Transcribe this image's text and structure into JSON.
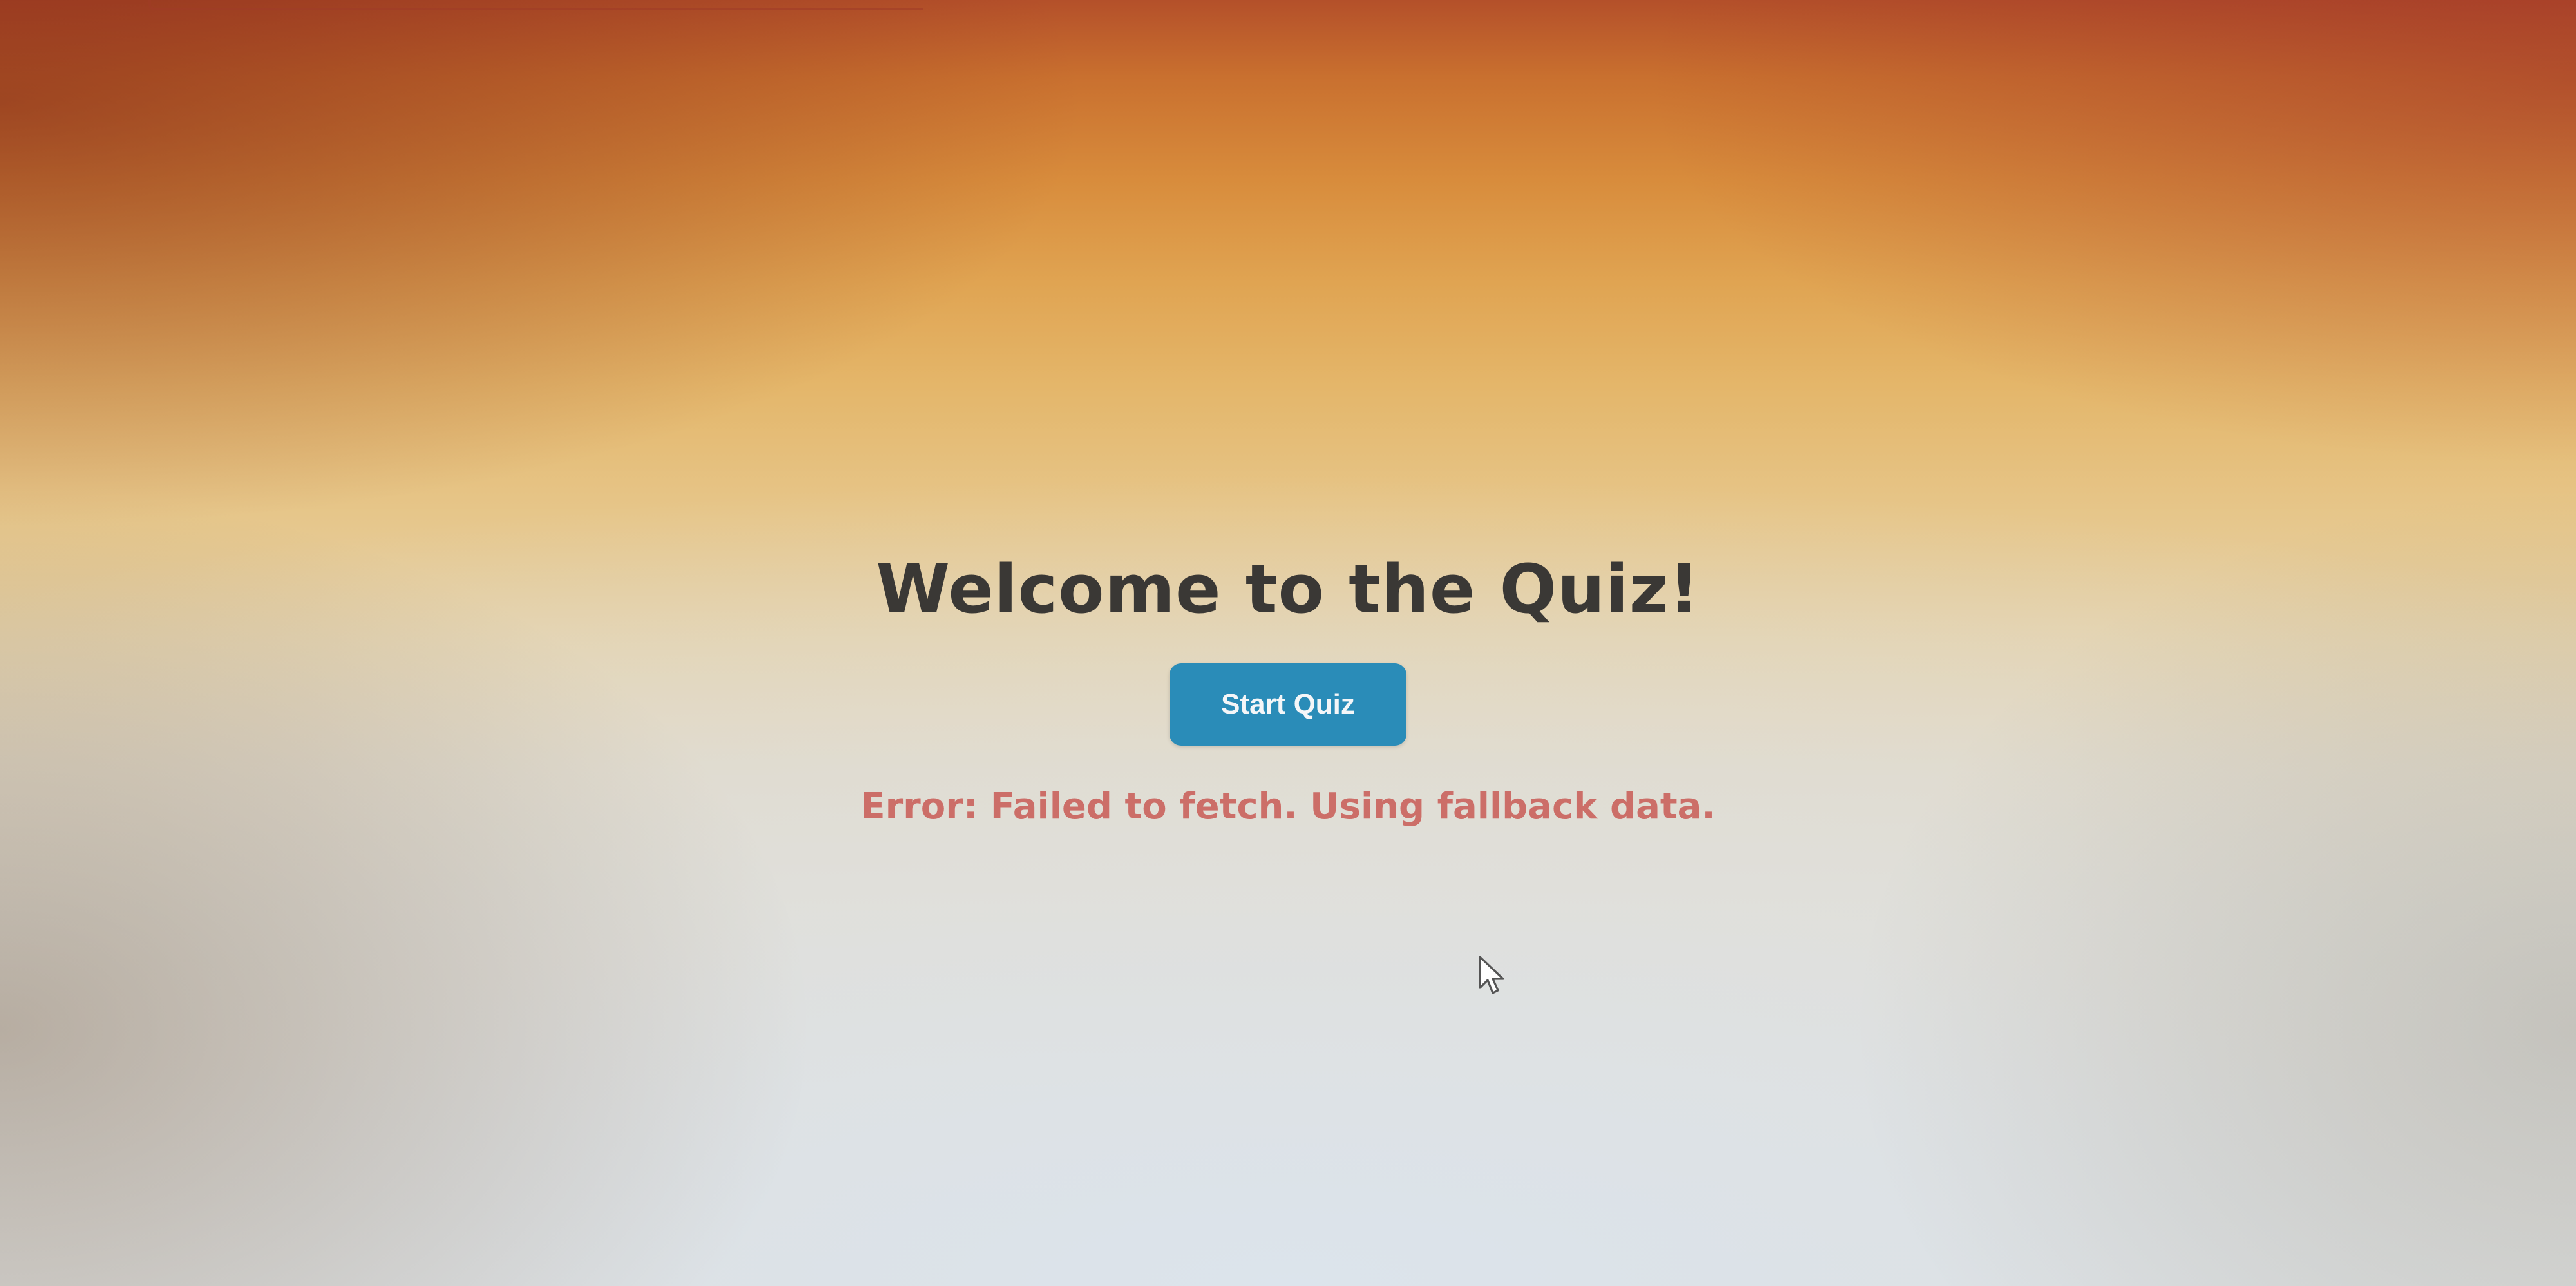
{
  "page": {
    "title": "Welcome to the Quiz!",
    "start_button_label": "Start Quiz",
    "error_message": "Error: Failed to fetch. Using fallback data."
  },
  "colors": {
    "title": "#3a3835",
    "button_background": "#2a8cb8",
    "button_text": "#f4f6f8",
    "error_text": "#cc6e68"
  },
  "icons": {
    "cursor": "mouse-pointer-icon"
  }
}
